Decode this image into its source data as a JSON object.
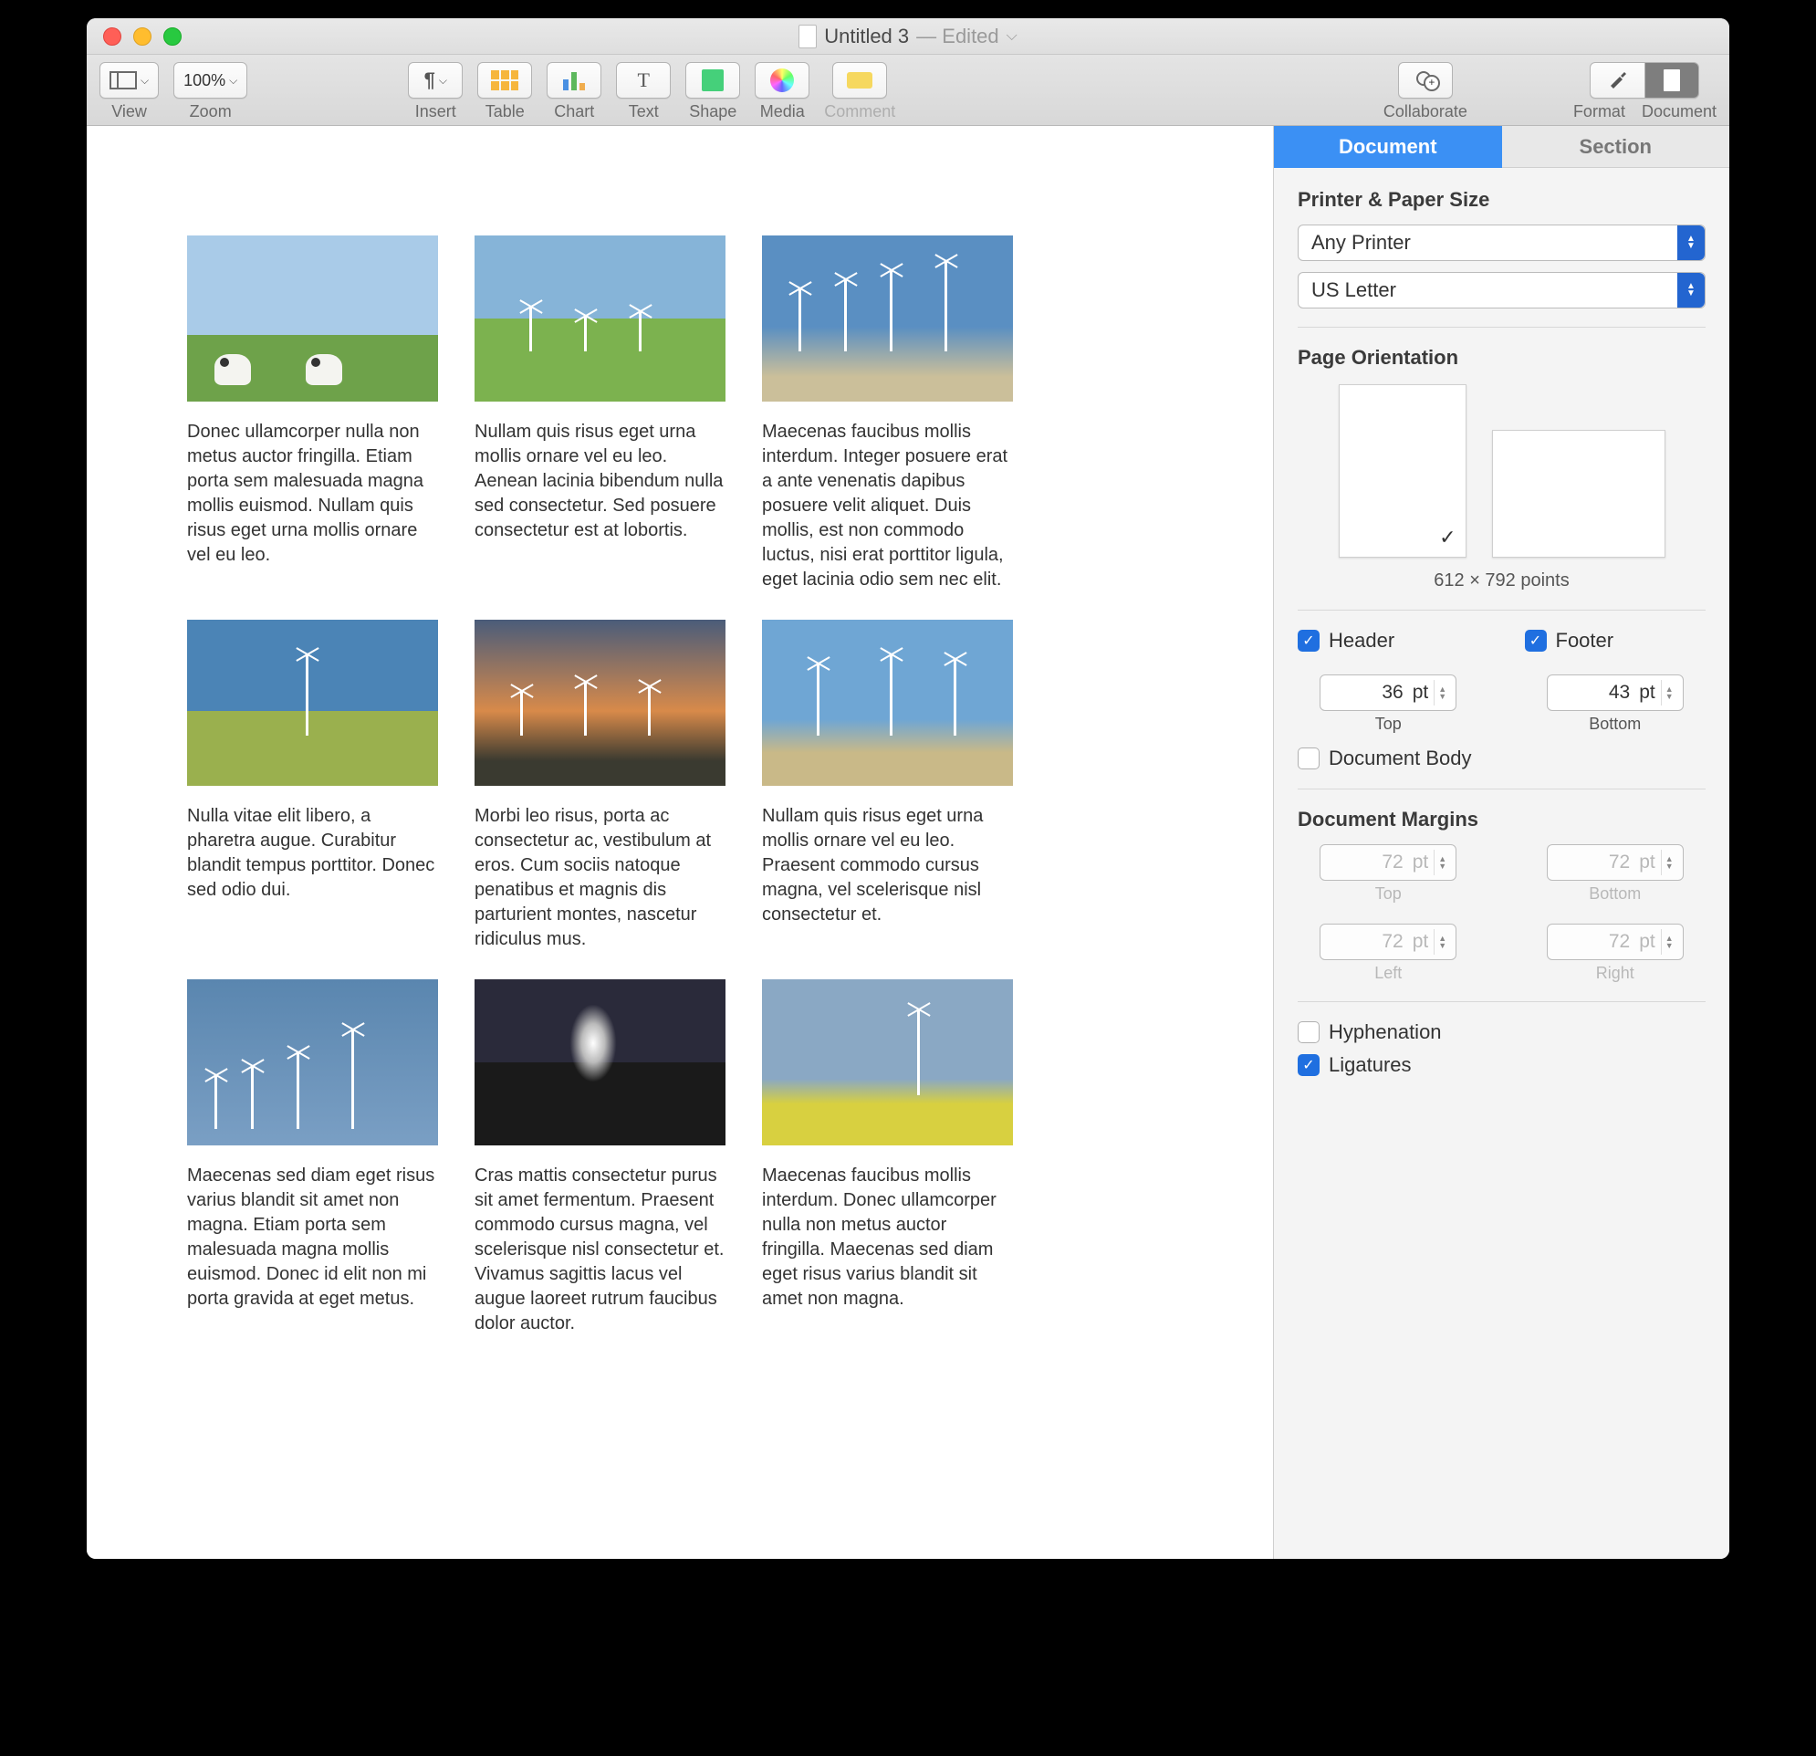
{
  "window": {
    "title": "Untitled 3",
    "status": "— Edited"
  },
  "toolbar": {
    "view": "View",
    "zoom_label": "Zoom",
    "zoom_value": "100%",
    "insert": "Insert",
    "table": "Table",
    "chart": "Chart",
    "text": "Text",
    "shape": "Shape",
    "media": "Media",
    "comment": "Comment",
    "collaborate": "Collaborate",
    "format": "Format",
    "document": "Document"
  },
  "document": {
    "cells": [
      {
        "caption": "Donec ullamcorper nulla non metus auctor fringilla. Etiam porta sem malesuada magna mollis euismod. Nullam quis risus eget urna mollis ornare vel eu leo."
      },
      {
        "caption": "Nullam quis risus eget urna mollis ornare vel eu leo. Aenean lacinia bibendum nulla sed consectetur. Sed posuere consectetur est at lobortis."
      },
      {
        "caption": "Maecenas faucibus mollis interdum. Integer posuere erat a ante venenatis dapibus posuere velit aliquet. Duis mollis, est non commodo luctus, nisi erat porttitor ligula, eget lacinia odio sem nec elit."
      },
      {
        "caption": "Nulla vitae elit libero, a pharetra augue. Curabitur blandit tempus porttitor. Donec sed odio dui."
      },
      {
        "caption": "Morbi leo risus, porta ac consectetur ac, vestibulum at eros. Cum sociis natoque penatibus et magnis dis parturient montes, nascetur ridiculus mus."
      },
      {
        "caption": "Nullam quis risus eget urna mollis ornare vel eu leo. Praesent commodo cursus magna, vel scelerisque nisl consectetur et."
      },
      {
        "caption": "Maecenas sed diam eget risus varius blandit sit amet non magna. Etiam porta sem malesuada magna mollis euismod. Donec id elit non mi porta gravida at eget metus."
      },
      {
        "caption": "Cras mattis consectetur purus sit amet fermentum. Praesent commodo cursus magna, vel scelerisque nisl consectetur et. Vivamus sagittis lacus vel augue laoreet rutrum faucibus dolor auctor."
      },
      {
        "caption": "Maecenas faucibus mollis interdum. Donec ullamcorper nulla non metus auctor fringilla. Maecenas sed diam eget risus varius blandit sit amet non magna."
      }
    ]
  },
  "inspector": {
    "tabs": {
      "document": "Document",
      "section": "Section"
    },
    "printer_paper_heading": "Printer & Paper Size",
    "printer": "Any Printer",
    "paper": "US Letter",
    "orientation_heading": "Page Orientation",
    "dimensions": "612 × 792 points",
    "header_label": "Header",
    "footer_label": "Footer",
    "header_value": "36",
    "header_unit": "pt",
    "header_sub": "Top",
    "footer_value": "43",
    "footer_unit": "pt",
    "footer_sub": "Bottom",
    "document_body_label": "Document Body",
    "margins_heading": "Document Margins",
    "margin_top_value": "72",
    "margin_top_unit": "pt",
    "margin_top_sub": "Top",
    "margin_bottom_value": "72",
    "margin_bottom_unit": "pt",
    "margin_bottom_sub": "Bottom",
    "margin_left_value": "72",
    "margin_left_unit": "pt",
    "margin_left_sub": "Left",
    "margin_right_value": "72",
    "margin_right_unit": "pt",
    "margin_right_sub": "Right",
    "hyphenation_label": "Hyphenation",
    "ligatures_label": "Ligatures"
  }
}
